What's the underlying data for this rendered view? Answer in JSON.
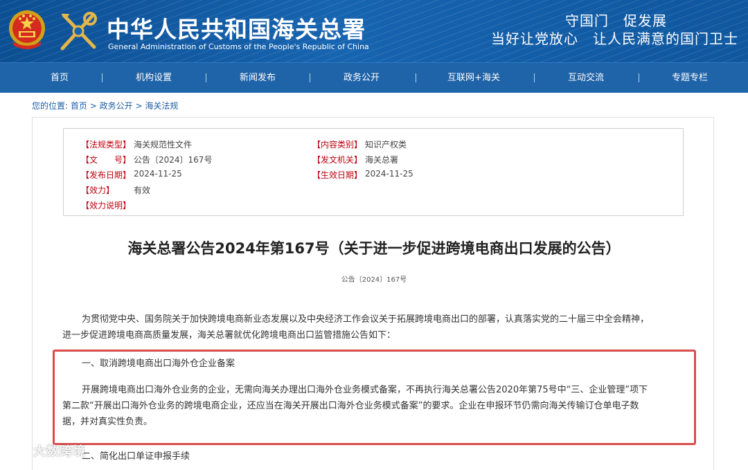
{
  "header": {
    "site_title": "中华人民共和国海关总署",
    "site_subtitle": "General Administration of Customs of the People's Republic of China",
    "slogan_line1": "守国门　促发展",
    "slogan_line2": "当好让党放心　让人民满意的国门卫士",
    "emblem_icon": "national-emblem-icon",
    "logo_icon": "customs-logo-icon"
  },
  "nav": {
    "items": [
      "首页",
      "机构设置",
      "新闻发布",
      "政务公开",
      "互联网+海关",
      "互动交流",
      "专题专栏"
    ]
  },
  "breadcrumb": {
    "prefix": "您的位置:",
    "items": [
      "首页",
      "政务公开",
      "海关法规"
    ],
    "separator": ">"
  },
  "meta": {
    "rows": [
      {
        "label": "【法规类型】",
        "value": "海关规范性文件"
      },
      {
        "label": "【文　　号】",
        "value": "公告〔2024〕167号"
      },
      {
        "label": "【发布日期】",
        "value": "2024-11-25"
      },
      {
        "label": "【效力】",
        "value": "有效"
      },
      {
        "label": "【效力说明】",
        "value": ""
      }
    ],
    "rows_right": [
      {
        "label": "【内容类别】",
        "value": "知识产权类"
      },
      {
        "label": "【发文机关】",
        "value": "海关总署"
      },
      {
        "label": "【生效日期】",
        "value": "2024-11-25"
      }
    ]
  },
  "document": {
    "title": "海关总署公告2024年第167号（关于进一步促进跨境电商出口发展的公告）",
    "number": "公告〔2024〕167号",
    "intro_line1": "为贯彻党中央、国务院关于加快跨境电商新业态发展以及中央经济工作会议关于拓展跨境电商出口的部署，认真落实党的二十届三中全会精神，",
    "intro_line2": "进一步促进跨境电商高质量发展，海关总署就优化跨境电商出口监管措施公告如下：",
    "section1_heading": "一、取消跨境电商出口海外仓企业备案",
    "section1_line1": "开展跨境电商出口海外仓业务的企业，无需向海关办理出口海外仓业务模式备案，不再执行海关总署公告2020年第75号中“三、企业管理”项下",
    "section1_line2": "第二款“开展出口海外仓业务的跨境电商企业，还应当在海关开展出口海外仓业务模式备案”的要求。企业在申报环节仍需向海关传输订仓单电子数",
    "section1_line3": "据，并对真实性负责。",
    "section2_heading": "二、简化出口单证申报手续"
  },
  "watermark": {
    "text": "大数跨境",
    "icon": "weibo-logo-icon"
  },
  "colors": {
    "banner": "#1764b0",
    "nav": "#1f63a8",
    "label_red": "#c0000c",
    "highlight_border": "#d94b4b",
    "link_blue": "#1d5ea5"
  }
}
